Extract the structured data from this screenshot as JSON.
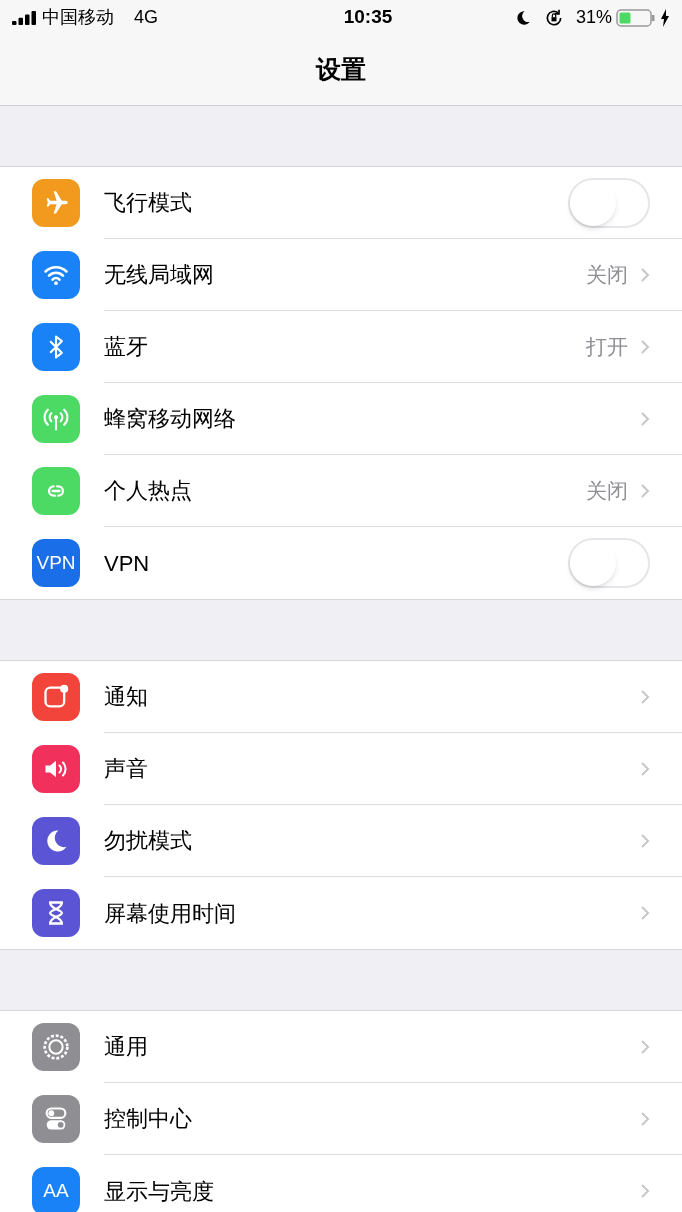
{
  "status_bar": {
    "carrier": "中国移动",
    "network": "4G",
    "time": "10:35",
    "battery": "31%"
  },
  "nav": {
    "title": "设置"
  },
  "groups": [
    {
      "rows": [
        {
          "label": "飞行模式",
          "kind": "toggle",
          "on": false,
          "color": "#f29a1e"
        },
        {
          "label": "无线局域网",
          "kind": "link",
          "value": "关闭",
          "color": "#1a82f7"
        },
        {
          "label": "蓝牙",
          "kind": "link",
          "value": "打开",
          "color": "#1a82f7"
        },
        {
          "label": "蜂窝移动网络",
          "kind": "link",
          "color": "#4cd964"
        },
        {
          "label": "个人热点",
          "kind": "link",
          "value": "关闭",
          "color": "#4cd964"
        },
        {
          "label": "VPN",
          "kind": "toggle",
          "on": false,
          "color": "#1a6fe8",
          "icon_text": "VPN"
        }
      ]
    },
    {
      "rows": [
        {
          "label": "通知",
          "kind": "link",
          "color": "#f2443a"
        },
        {
          "label": "声音",
          "kind": "link",
          "color": "#f1305b"
        },
        {
          "label": "勿扰模式",
          "kind": "link",
          "color": "#5b55d6"
        },
        {
          "label": "屏幕使用时间",
          "kind": "link",
          "color": "#5b55d6"
        }
      ]
    },
    {
      "rows": [
        {
          "label": "通用",
          "kind": "link",
          "color": "#8e8e93"
        },
        {
          "label": "控制中心",
          "kind": "link",
          "color": "#8e8e93"
        },
        {
          "label": "显示与亮度",
          "kind": "link",
          "color": "#1a82f7",
          "icon_text": "AA"
        }
      ]
    }
  ]
}
